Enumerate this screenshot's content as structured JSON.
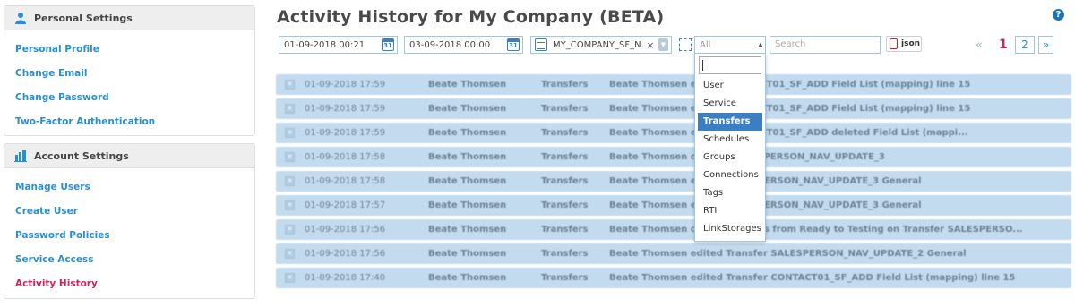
{
  "sidebar": {
    "personal": {
      "header": "Personal Settings",
      "items": [
        "Personal Profile",
        "Change Email",
        "Change Password",
        "Two-Factor Authentication"
      ]
    },
    "account": {
      "header": "Account Settings",
      "items": [
        "Manage Users",
        "Create User",
        "Password Policies",
        "Service Access",
        "Activity History"
      ]
    }
  },
  "page": {
    "title": "Activity History for My Company (BETA)",
    "help_icon": "?"
  },
  "filters": {
    "from_date": "01-09-2018 00:21",
    "to_date": "03-09-2018 00:00",
    "company": "MY_COMPANY_SF_N...",
    "type_selected": "All",
    "search_placeholder": "Search",
    "json_label": "json",
    "cal_label": "31"
  },
  "pagination": {
    "prev": "«",
    "current": "1",
    "page2": "2",
    "next": "»"
  },
  "dropdown": {
    "items": [
      "User",
      "Service",
      "Transfers",
      "Schedules",
      "Groups",
      "Connections",
      "Tags",
      "RTI",
      "LinkStorages"
    ],
    "highlighted": "Transfers"
  },
  "rows": [
    {
      "date": "01-09-2018 17:59",
      "user": "Beate Thomsen",
      "type": "Transfers",
      "desc": "Beate Thomsen edited CONTACT01_SF_ADD Field List (mapping) line 15"
    },
    {
      "date": "01-09-2018 17:59",
      "user": "Beate Thomsen",
      "type": "Transfers",
      "desc": "Beate Thomsen edited CONTACT01_SF_ADD Field List (mapping) line 15"
    },
    {
      "date": "01-09-2018 17:59",
      "user": "Beate Thomsen",
      "type": "Transfers",
      "desc": "Beate Thomsen edited CONTACT01_SF_ADD deleted Field List (mappi..."
    },
    {
      "date": "01-09-2018 17:58",
      "user": "Beate Thomsen",
      "type": "Transfers",
      "desc": "Beate Thomsen deleted SALESPERSON_NAV_UPDATE_3"
    },
    {
      "date": "01-09-2018 17:58",
      "user": "Beate Thomsen",
      "type": "Transfers",
      "desc": "Beate Thomsen edited SALESPERSON_NAV_UPDATE_3 General"
    },
    {
      "date": "01-09-2018 17:57",
      "user": "Beate Thomsen",
      "type": "Transfers",
      "desc": "Beate Thomsen edited SALESPERSON_NAV_UPDATE_3 General"
    },
    {
      "date": "01-09-2018 17:56",
      "user": "Beate Thomsen",
      "type": "Transfers",
      "desc": "Beate Thomsen changed Status from Ready to Testing on Transfer SALESPERSO..."
    },
    {
      "date": "01-09-2018 17:56",
      "user": "Beate Thomsen",
      "type": "Transfers",
      "desc": "Beate Thomsen edited Transfer SALESPERSON_NAV_UPDATE_2 General"
    },
    {
      "date": "01-09-2018 17:40",
      "user": "Beate Thomsen",
      "type": "Transfers",
      "desc": "Beate Thomsen edited Transfer CONTACT01_SF_ADD Field List (mapping) line 15"
    }
  ],
  "colors": {
    "accent": "#2a8fd1",
    "active": "#d0245c",
    "highlight": "#3b7fc2",
    "row_bg": "#c3dbee"
  }
}
